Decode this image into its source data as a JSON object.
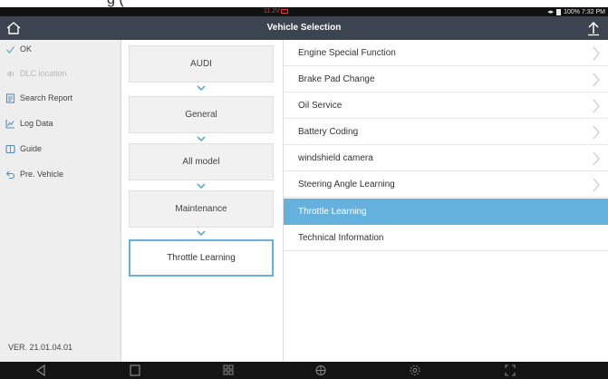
{
  "status": {
    "voltage": "11.2V",
    "right": "100% 7:32 PM"
  },
  "header": {
    "title": "Vehicle Selection"
  },
  "sidebar": {
    "items": [
      {
        "label": "OK",
        "icon": "check-icon",
        "enabled": true
      },
      {
        "label": "DLC location",
        "icon": "dlc-icon",
        "enabled": false
      },
      {
        "label": "Search Report",
        "icon": "report-icon",
        "enabled": true
      },
      {
        "label": "Log Data",
        "icon": "log-data-icon",
        "enabled": true
      },
      {
        "label": "Guide",
        "icon": "guide-icon",
        "enabled": true
      },
      {
        "label": "Pre. Vehicle",
        "icon": "return-icon",
        "enabled": true
      }
    ],
    "version": "VER. 21.01.04.01"
  },
  "breadcrumb": {
    "items": [
      "AUDI",
      "General",
      "All model",
      "Maintenance",
      "Throttle Learning"
    ]
  },
  "functions": {
    "items": [
      {
        "label": "Engine Special Function",
        "has_arrow": true
      },
      {
        "label": "Brake Pad Change",
        "has_arrow": true
      },
      {
        "label": "Oil Service",
        "has_arrow": true
      },
      {
        "label": "Battery Coding",
        "has_arrow": true
      },
      {
        "label": "windshield camera",
        "has_arrow": true
      },
      {
        "label": "Steering Angle Learning",
        "has_arrow": true
      },
      {
        "label": "Throttle Learning",
        "has_arrow": false,
        "selected": true
      },
      {
        "label": "Technical Information",
        "has_arrow": false
      }
    ]
  },
  "colors": {
    "accent": "#64b1dd",
    "titlebar": "#3c4450",
    "sidebar": "#eeeeef",
    "chevron": "#5aa9d8"
  }
}
